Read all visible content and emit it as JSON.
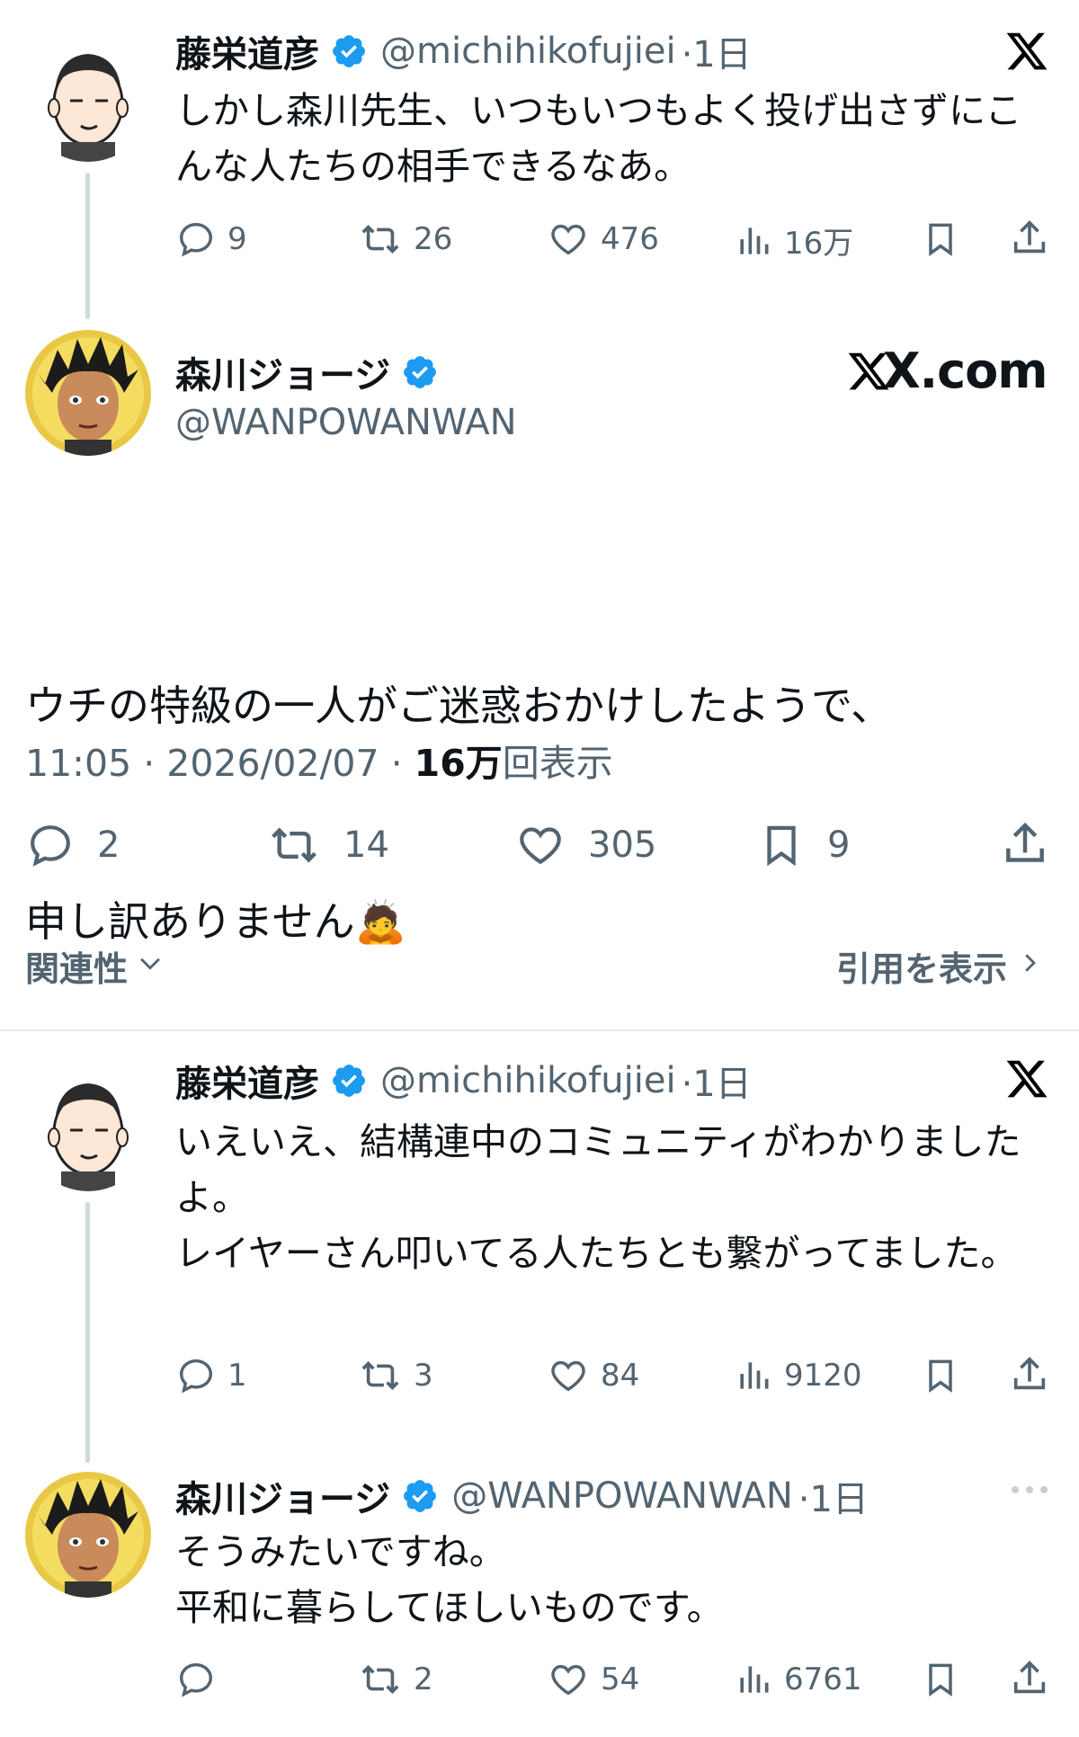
{
  "top_reply": {
    "author_name": "藤栄道彦",
    "author_handle": "@michihikofujiei",
    "age": "·1日",
    "text": "しかし森川先生、いつもいつもよく投げ出さずにこんな人たちの相手できるなあ。",
    "replies": "9",
    "retweets": "26",
    "likes": "476",
    "views": "16万",
    "platform_icon": "x-logo-icon"
  },
  "main_tweet": {
    "author_name": "森川ジョージ",
    "author_handle": "@WANPOWANWAN",
    "site": "X.com",
    "text_line1": "ウチの特級の一人がご迷惑おかけしたようで、",
    "text_line2": "申し訳ありません",
    "emoji": "🙇",
    "time": "11:05 · 2026/02/07 · ",
    "views_count": "16万",
    "views_label": "回表示",
    "replies": "2",
    "retweets": "14",
    "likes": "305",
    "bookmarks": "9",
    "sort_label": "関連性",
    "quotes_label": "引用を表示"
  },
  "reply2": {
    "author_name": "藤栄道彦",
    "author_handle": "@michihikofujiei",
    "age": "·1日",
    "text": "いえいえ、結構連中のコミュニティがわかりました よ。\nレイヤーさん叩いてる人たちとも繋がってました。",
    "replies": "1",
    "retweets": "3",
    "likes": "84",
    "views": "9120"
  },
  "reply3": {
    "author_name": "森川ジョージ",
    "author_handle": "@WANPOWANWAN",
    "age": "·1日",
    "text": "そうみたいですね。\n平和に暮らしてほしいものです。",
    "replies": "",
    "retweets": "2",
    "likes": "54",
    "views": "6761"
  },
  "colors": {
    "verified": "#1d9bf0",
    "secondary": "#536471",
    "primary": "#0f1419",
    "thread_line": "#cfd9de"
  }
}
